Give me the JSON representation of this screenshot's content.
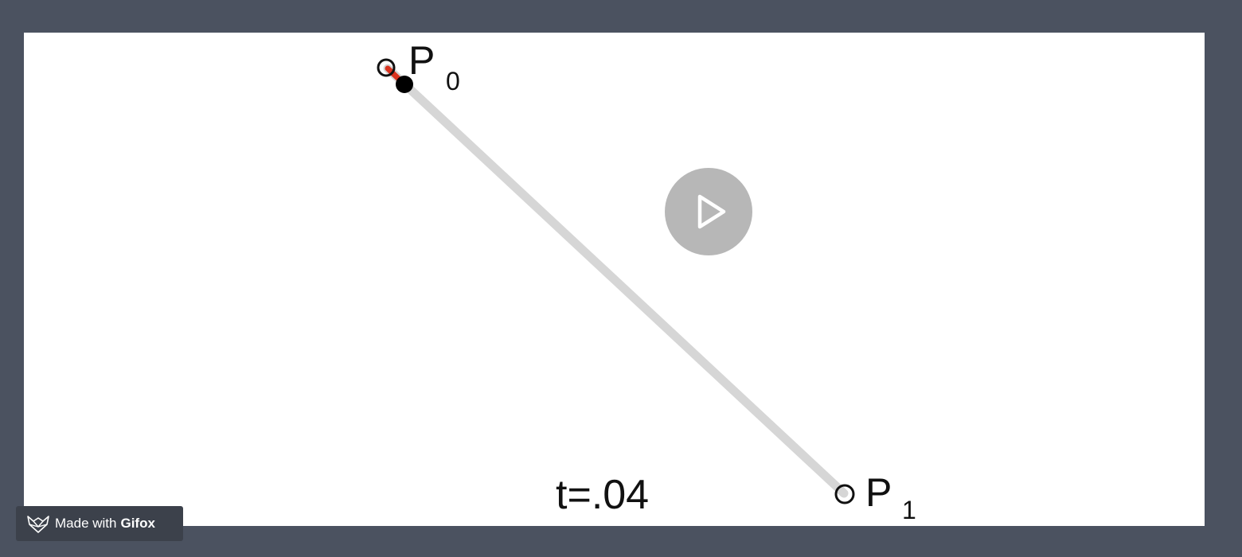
{
  "animation": {
    "point_start": {
      "letter": "P",
      "subscript": "0"
    },
    "point_end": {
      "letter": "P",
      "subscript": "1"
    },
    "t_label": "t=.04",
    "t_value": 0.04,
    "colors": {
      "segment": "#d6d6d6",
      "progress": "#d9331f",
      "moving_point": "#000000",
      "control_point_stroke": "#111111"
    }
  },
  "player": {
    "play_icon": "play-icon"
  },
  "watermark": {
    "prefix": "Made with",
    "brand": "Gifox",
    "icon": "fox-icon"
  }
}
